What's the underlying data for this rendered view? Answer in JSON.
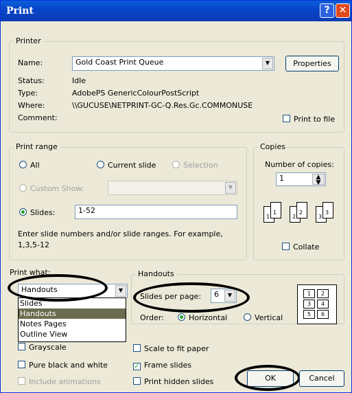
{
  "window": {
    "title": "Print",
    "help_glyph": "?",
    "close_glyph": "✕"
  },
  "printer": {
    "legend": "Printer",
    "name_label": "Name:",
    "name_value": "Gold Coast Print Queue",
    "properties_label": "Properties",
    "status_label": "Status:",
    "status_value": "Idle",
    "type_label": "Type:",
    "type_value": "AdobePS GenericColourPostScript",
    "where_label": "Where:",
    "where_value": "\\\\GUCUSE\\NETPRINT-GC-Q.Res.Gc.COMMONUSE",
    "comment_label": "Comment:",
    "print_to_file_label": "Print to file"
  },
  "print_range": {
    "legend": "Print range",
    "all_label": "All",
    "current_slide_label": "Current slide",
    "selection_label": "Selection",
    "custom_show_label": "Custom Show:",
    "slides_label": "Slides:",
    "slides_value": "1-52",
    "hint": "Enter slide numbers and/or slide ranges. For example,",
    "hint2": "1,3,5-12"
  },
  "copies": {
    "legend": "Copies",
    "number_label": "Number of copies:",
    "number_value": "1",
    "collate_label": "Collate",
    "collate_digits": [
      "1",
      "1",
      "2",
      "2",
      "3",
      "3"
    ]
  },
  "print_what": {
    "label": "Print what:",
    "value": "Handouts",
    "options": [
      "Slides",
      "Handouts",
      "Notes Pages",
      "Outline View"
    ],
    "selected_index": 1
  },
  "handouts": {
    "legend": "Handouts",
    "per_page_label": "Slides per page:",
    "per_page_value": "6",
    "order_label": "Order:",
    "horizontal_label": "Horizontal",
    "vertical_label": "Vertical",
    "preview_digits": [
      "1",
      "2",
      "3",
      "4",
      "5",
      "6"
    ]
  },
  "options": {
    "grayscale_label": "Grayscale",
    "pure_bw_label": "Pure black and white",
    "include_animations_label": "Include animations",
    "scale_to_fit_label": "Scale to fit paper",
    "frame_slides_label": "Frame slides",
    "print_hidden_label": "Print hidden slides"
  },
  "buttons": {
    "ok_label": "OK",
    "cancel_label": "Cancel"
  },
  "colors": {
    "titlebar": "#0846c9",
    "dialog": "#ece9d8",
    "selection": "#6b6b4f",
    "radio_dot": "#21a121"
  }
}
